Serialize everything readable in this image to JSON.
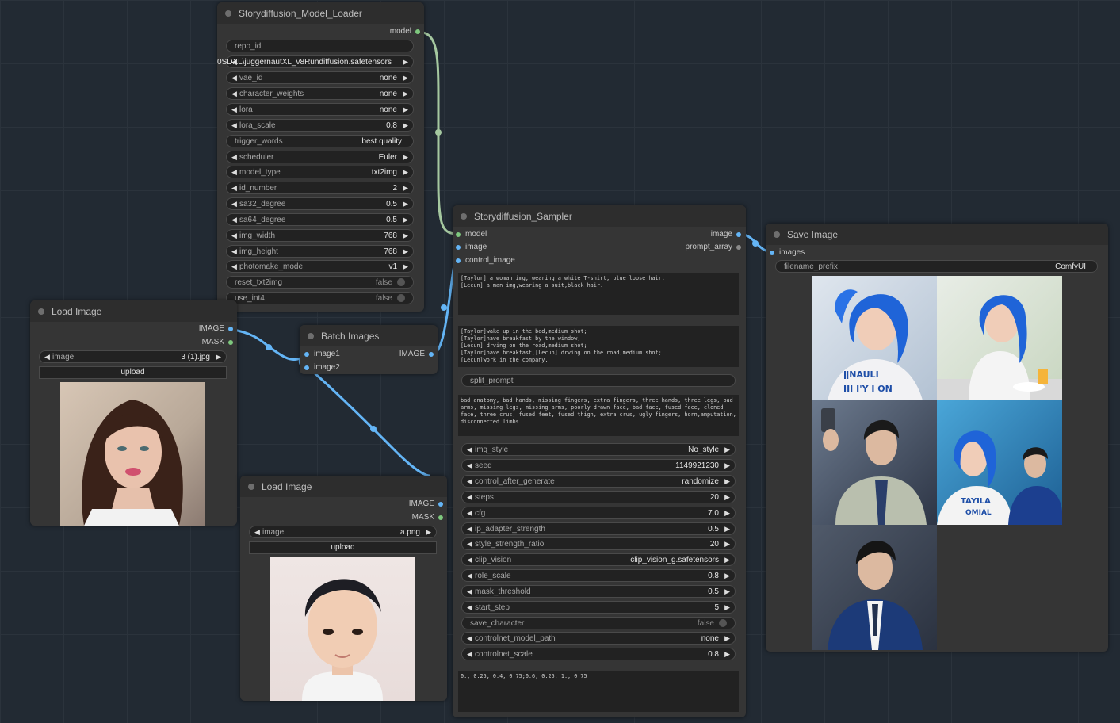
{
  "colors": {
    "canvas": "#222a33",
    "node": "#353535",
    "link_model": "#a5c8a0",
    "link_image": "#64b5f6"
  },
  "model_loader": {
    "title": "Storydiffusion_Model_Loader",
    "output_model": "model",
    "repo_id": {
      "label": "repo_id"
    },
    "ckpt_overlap_text": "0SDXL\\juggernautXL_v8Rundiffusion.safetensors",
    "vae_id": {
      "label": "vae_id",
      "value": "none"
    },
    "character_weights": {
      "label": "character_weights",
      "value": "none"
    },
    "lora": {
      "label": "lora",
      "value": "none"
    },
    "lora_scale": {
      "label": "lora_scale",
      "value": "0.8"
    },
    "trigger_words": {
      "label": "trigger_words",
      "value": "best quality"
    },
    "scheduler": {
      "label": "scheduler",
      "value": "Euler"
    },
    "model_type": {
      "label": "model_type",
      "value": "txt2img"
    },
    "id_number": {
      "label": "id_number",
      "value": "2"
    },
    "sa32_degree": {
      "label": "sa32_degree",
      "value": "0.5"
    },
    "sa64_degree": {
      "label": "sa64_degree",
      "value": "0.5"
    },
    "img_width": {
      "label": "img_width",
      "value": "768"
    },
    "img_height": {
      "label": "img_height",
      "value": "768"
    },
    "photomake_mode": {
      "label": "photomake_mode",
      "value": "v1"
    },
    "reset_txt2img": {
      "label": "reset_txt2img",
      "value": "false"
    },
    "use_int4": {
      "label": "use_int4",
      "value": "false"
    }
  },
  "load_image_1": {
    "title": "Load Image",
    "out_image": "IMAGE",
    "out_mask": "MASK",
    "image": {
      "label": "image",
      "value": "3 (1).jpg"
    },
    "upload": "upload",
    "preview_icon": "woman-portrait"
  },
  "batch_images": {
    "title": "Batch Images",
    "in1": "image1",
    "in2": "image2",
    "out": "IMAGE"
  },
  "load_image_2": {
    "title": "Load Image",
    "out_image": "IMAGE",
    "out_mask": "MASK",
    "image": {
      "label": "image",
      "value": "a.png"
    },
    "upload": "upload",
    "preview_icon": "man-portrait"
  },
  "sampler": {
    "title": "Storydiffusion_Sampler",
    "in_model": "model",
    "in_image": "image",
    "in_control": "control_image",
    "out_image": "image",
    "out_prompt": "prompt_array",
    "character_prompt": "[Taylor] a woman img, wearing a white T-shirt, blue loose hair.\n[Lecun] a man img,wearing a suit,black hair.",
    "scene_prompts": "[Taylor]wake up in the bed,medium shot;\n[Taylor]have breakfast by the window;\n[Lecun] drving on the road,medium shot;\n[Taylor]have breakfast,[Lecun] drving on the road,medium shot;\n[Lecun]work in the company.",
    "split_prompt": {
      "label": "split_prompt"
    },
    "negative_prompt": "bad anatomy, bad hands, missing fingers, extra fingers, three hands, three legs, bad arms, missing legs, missing arms, poorly drawn face, bad face, fused face, cloned face, three crus, fused feet, fused thigh, extra crus, ugly fingers, horn,amputation, disconnected limbs",
    "img_style": {
      "label": "img_style",
      "value": "No_style"
    },
    "seed": {
      "label": "seed",
      "value": "1149921230"
    },
    "control_after_generate": {
      "label": "control_after_generate",
      "value": "randomize"
    },
    "steps": {
      "label": "steps",
      "value": "20"
    },
    "cfg": {
      "label": "cfg",
      "value": "7.0"
    },
    "ip_adapter_strength": {
      "label": "ip_adapter_strength",
      "value": "0.5"
    },
    "style_strength_ratio": {
      "label": "style_strength_ratio",
      "value": "20"
    },
    "clip_vision": {
      "label": "clip_vision",
      "value": "clip_vision_g.safetensors"
    },
    "role_scale": {
      "label": "role_scale",
      "value": "0.8"
    },
    "mask_threshold": {
      "label": "mask_threshold",
      "value": "0.5"
    },
    "start_step": {
      "label": "start_step",
      "value": "5"
    },
    "save_character": {
      "label": "save_character",
      "value": "false"
    },
    "controlnet_model_path": {
      "label": "controlnet_model_path",
      "value": "none"
    },
    "controlnet_scale": {
      "label": "controlnet_scale",
      "value": "0.8"
    },
    "layout_text": "0., 0.25, 0.4, 0.75;0.6, 0.25, 1., 0.75"
  },
  "save_image": {
    "title": "Save Image",
    "in_images": "images",
    "filename_prefix": {
      "label": "filename_prefix",
      "value": "ComfyUI"
    },
    "images": [
      {
        "icon": "woman-blue-hair-tshirt-image",
        "shirt_text": "ǁNAULI\nIII I'Y I ON"
      },
      {
        "icon": "woman-breakfast-image"
      },
      {
        "icon": "man-driving-car-image"
      },
      {
        "icon": "woman-and-man-in-car-image",
        "shirt_text": "TAYILA\nOMIAL"
      },
      {
        "icon": "man-in-suit-office-image"
      }
    ]
  }
}
